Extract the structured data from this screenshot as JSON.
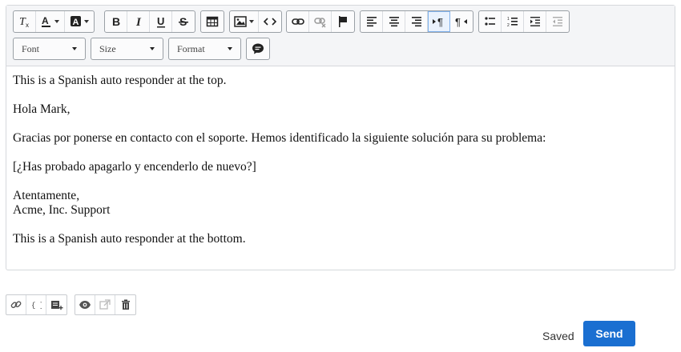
{
  "toolbar": {
    "font_label": "Font",
    "size_label": "Size",
    "format_label": "Format"
  },
  "content": {
    "lines": [
      "This is a Spanish auto responder at the top.",
      "Hola Mark,",
      "Gracias por ponerse en contacto con el soporte. Hemos identificado la siguiente solución para su problema:",
      "[¿Has probado apagarlo y encenderlo de nuevo?]",
      "Atentamente,",
      "Acme, Inc. Support",
      "This is a Spanish auto responder at the bottom."
    ]
  },
  "footer": {
    "status": "Saved",
    "send_label": "Send"
  },
  "colors": {
    "send_button": "#1a6fd1",
    "active_button": "#eaf2fd"
  }
}
